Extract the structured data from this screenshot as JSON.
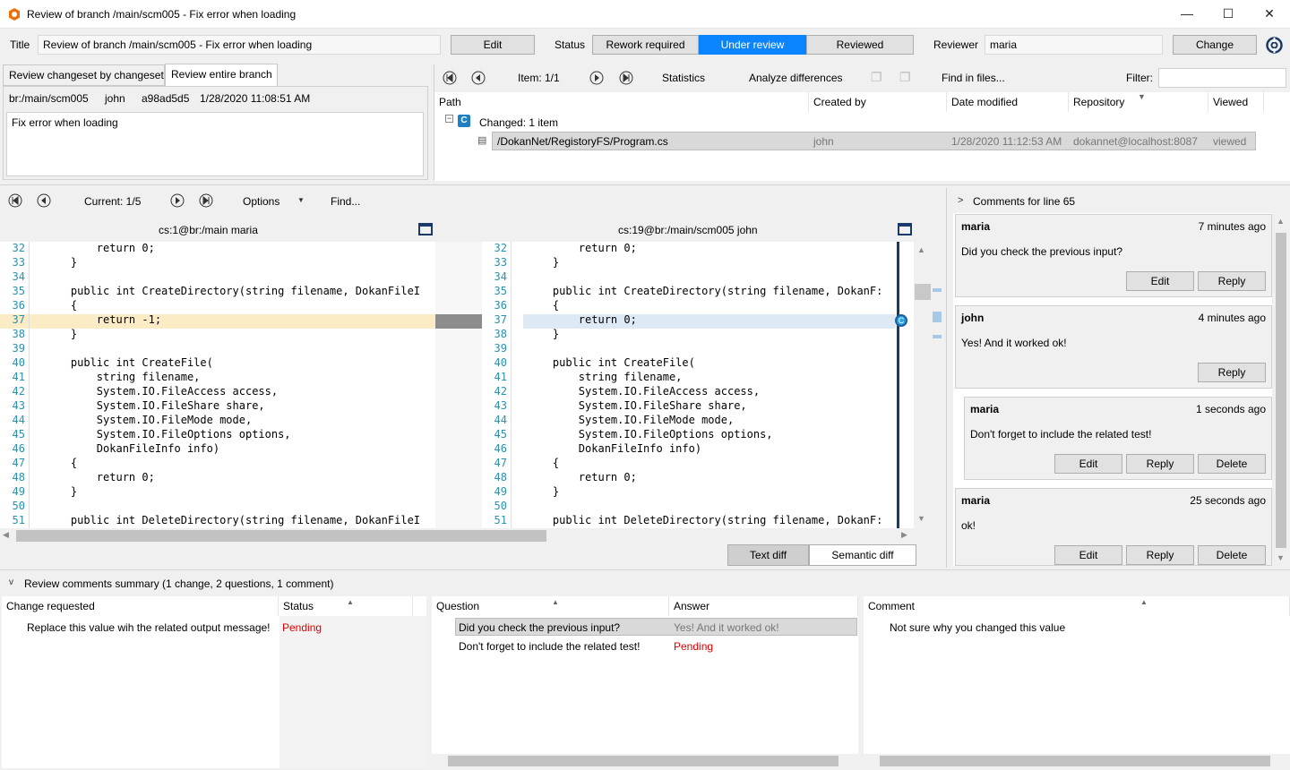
{
  "window": {
    "title": "Review of branch /main/scm005 - Fix error when loading",
    "minimize": "—",
    "maximize": "☐",
    "close": "✕"
  },
  "header": {
    "title_label": "Title",
    "title_value": "Review of branch /main/scm005 - Fix error when loading",
    "edit": "Edit",
    "status_label": "Status",
    "status_options": [
      "Rework required",
      "Under review",
      "Reviewed"
    ],
    "reviewer_label": "Reviewer",
    "reviewer_value": "maria",
    "change": "Change"
  },
  "left_top": {
    "tabs": [
      "Review changeset by changeset",
      "Review entire branch"
    ],
    "branch": "br:/main/scm005",
    "author": "john",
    "changeset": "a98ad5d5",
    "date": "1/28/2020 11:08:51 AM",
    "description": "Fix error when loading"
  },
  "right_top": {
    "item": "Item: 1/1",
    "statistics": "Statistics",
    "analyze": "Analyze differences",
    "find": "Find in files...",
    "filter_label": "Filter:",
    "filter_value": "",
    "columns": [
      "Path",
      "Created by",
      "Date modified",
      "Repository",
      "Viewed"
    ],
    "group": "Changed: 1 item",
    "row": {
      "path": "/DokanNet/RegistoryFS/Program.cs",
      "created_by": "john",
      "date": "1/28/2020 11:12:53 AM",
      "repo": "dokannet@localhost:8087",
      "viewed": "viewed"
    }
  },
  "diff": {
    "current": "Current: 1/5",
    "options": "Options",
    "find": "Find...",
    "left_title": "cs:1@br:/main maria",
    "right_title": "cs:19@br:/main/scm005 john",
    "text_diff": "Text diff",
    "semantic_diff": "Semantic diff",
    "left_lines": [
      [
        "32",
        "        return 0;"
      ],
      [
        "33",
        "    }"
      ],
      [
        "34",
        ""
      ],
      [
        "35",
        "    public int CreateDirectory(string filename, DokanFileI"
      ],
      [
        "36",
        "    {"
      ],
      [
        "37",
        "        return -1;"
      ],
      [
        "38",
        "    }"
      ],
      [
        "39",
        ""
      ],
      [
        "40",
        "    public int CreateFile("
      ],
      [
        "41",
        "        string filename,"
      ],
      [
        "42",
        "        System.IO.FileAccess access,"
      ],
      [
        "43",
        "        System.IO.FileShare share,"
      ],
      [
        "44",
        "        System.IO.FileMode mode,"
      ],
      [
        "45",
        "        System.IO.FileOptions options,"
      ],
      [
        "46",
        "        DokanFileInfo info)"
      ],
      [
        "47",
        "    {"
      ],
      [
        "48",
        "        return 0;"
      ],
      [
        "49",
        "    }"
      ],
      [
        "50",
        ""
      ],
      [
        "51",
        "    public int DeleteDirectory(string filename, DokanFileI"
      ]
    ],
    "right_lines": [
      [
        "32",
        "        return 0;"
      ],
      [
        "33",
        "    }"
      ],
      [
        "34",
        ""
      ],
      [
        "35",
        "    public int CreateDirectory(string filename, DokanF:"
      ],
      [
        "36",
        "    {"
      ],
      [
        "37",
        "        return 0;"
      ],
      [
        "38",
        "    }"
      ],
      [
        "39",
        ""
      ],
      [
        "40",
        "    public int CreateFile("
      ],
      [
        "41",
        "        string filename,"
      ],
      [
        "42",
        "        System.IO.FileAccess access,"
      ],
      [
        "43",
        "        System.IO.FileShare share,"
      ],
      [
        "44",
        "        System.IO.FileMode mode,"
      ],
      [
        "45",
        "        System.IO.FileOptions options,"
      ],
      [
        "46",
        "        DokanFileInfo info)"
      ],
      [
        "47",
        "    {"
      ],
      [
        "48",
        "        return 0;"
      ],
      [
        "49",
        "    }"
      ],
      [
        "50",
        ""
      ],
      [
        "51",
        "    public int DeleteDirectory(string filename, DokanF:"
      ]
    ]
  },
  "comments": {
    "header": "Comments for line 65",
    "cards": [
      {
        "who": "maria",
        "when": "7 minutes ago",
        "text": "Did you check the previous input?",
        "buttons": [
          "Edit",
          "Reply"
        ]
      },
      {
        "who": "john",
        "when": "4 minutes ago",
        "text": "Yes! And it worked ok!",
        "buttons": [
          "Reply"
        ]
      },
      {
        "who": "maria",
        "when": "1 seconds ago",
        "text": "Don't forget to include the related test!",
        "buttons": [
          "Edit",
          "Reply",
          "Delete"
        ]
      },
      {
        "who": "maria",
        "when": "25 seconds ago",
        "text": "ok!",
        "buttons": [
          "Edit",
          "Reply",
          "Delete"
        ]
      }
    ]
  },
  "summary": {
    "title": "Review comments summary (1 change, 2 questions, 1 comment)",
    "change_cols": [
      "Change requested",
      "Status"
    ],
    "change_rows": [
      [
        "Replace this value wih the related output message!",
        "Pending"
      ]
    ],
    "question_cols": [
      "Question",
      "Answer"
    ],
    "question_rows": [
      [
        "Did you check the previous input?",
        "Yes! And it worked ok!"
      ],
      [
        "Don't forget to include the related test!",
        "Pending"
      ]
    ],
    "comment_cols": [
      "Comment"
    ],
    "comment_rows": [
      "Not sure why you changed this value"
    ]
  },
  "colors": {
    "accent": "#0078d7",
    "added_highlight": "#dde9f5",
    "removed_highlight": "#fcecc6",
    "pending": "#e00000"
  }
}
